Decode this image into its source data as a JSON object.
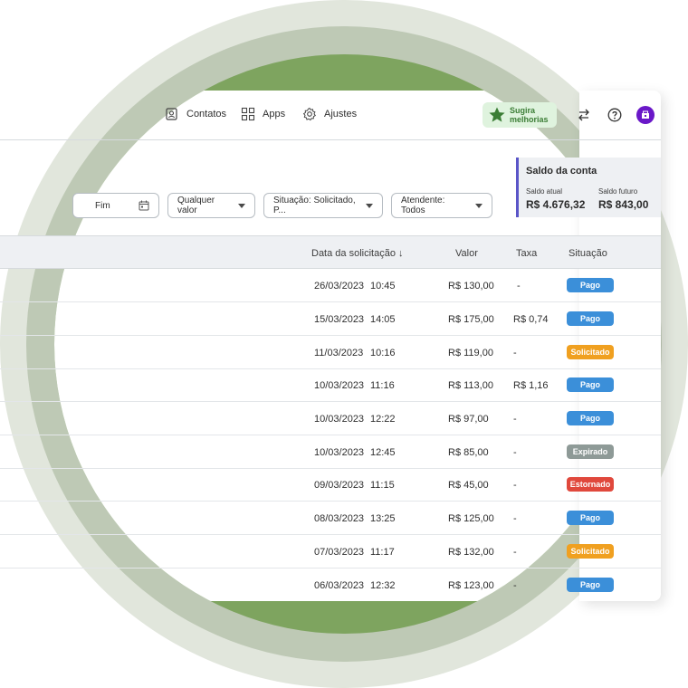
{
  "nav": {
    "items": [
      {
        "label": "Contatos",
        "icon": "contacts-icon"
      },
      {
        "label": "Apps",
        "icon": "apps-grid-icon"
      },
      {
        "label": "Ajustes",
        "icon": "gear-icon"
      }
    ],
    "suggest_label_line1": "Sugira",
    "suggest_label_line2": "melhorias"
  },
  "filters": {
    "date_end": "Fim",
    "value": "Qualquer valor",
    "status": "Situação: Solicitado, P...",
    "attendant": "Atendente: Todos"
  },
  "balance": {
    "title": "Saldo da conta",
    "current_label": "Saldo atual",
    "current_value": "R$ 4.676,32",
    "future_label": "Saldo futuro",
    "future_value": "R$ 843,00"
  },
  "table": {
    "headers": {
      "date": "Data da solicitação ↓",
      "value": "Valor",
      "fee": "Taxa",
      "status": "Situação"
    },
    "rows": [
      {
        "date": "26/03/2023",
        "time": "10:45",
        "value": "R$ 130,00",
        "fee": "-",
        "status": "Pago"
      },
      {
        "date": "15/03/2023",
        "time": "14:05",
        "value": "R$ 175,00",
        "fee": "R$ 0,74",
        "status": "Pago"
      },
      {
        "date": "11/03/2023",
        "time": "10:16",
        "value": "R$ 119,00",
        "fee": "-",
        "status": "Solicitado"
      },
      {
        "date": "10/03/2023",
        "time": "11:16",
        "value": "R$ 113,00",
        "fee": "R$ 1,16",
        "status": "Pago"
      },
      {
        "date": "10/03/2023",
        "time": "12:22",
        "value": "R$ 97,00",
        "fee": "-",
        "status": "Pago"
      },
      {
        "date": "10/03/2023",
        "time": "12:45",
        "value": "R$ 85,00",
        "fee": "-",
        "status": "Expirado"
      },
      {
        "date": "09/03/2023",
        "time": "11:15",
        "value": "R$ 45,00",
        "fee": "-",
        "status": "Estornado"
      },
      {
        "date": "08/03/2023",
        "time": "13:25",
        "value": "R$ 125,00",
        "fee": "-",
        "status": "Pago"
      },
      {
        "date": "07/03/2023",
        "time": "11:17",
        "value": "R$ 132,00",
        "fee": "-",
        "status": "Solicitado"
      },
      {
        "date": "06/03/2023",
        "time": "12:32",
        "value": "R$ 123,00",
        "fee": "-",
        "status": "Pago"
      }
    ]
  },
  "colors": {
    "Pago": "#3b8fd9",
    "Solicitado": "#f0a020",
    "Expirado": "#8e9a97",
    "Estornado": "#e0483c",
    "accent_green": "#3b7d35",
    "avatar": "#6a18c8"
  }
}
